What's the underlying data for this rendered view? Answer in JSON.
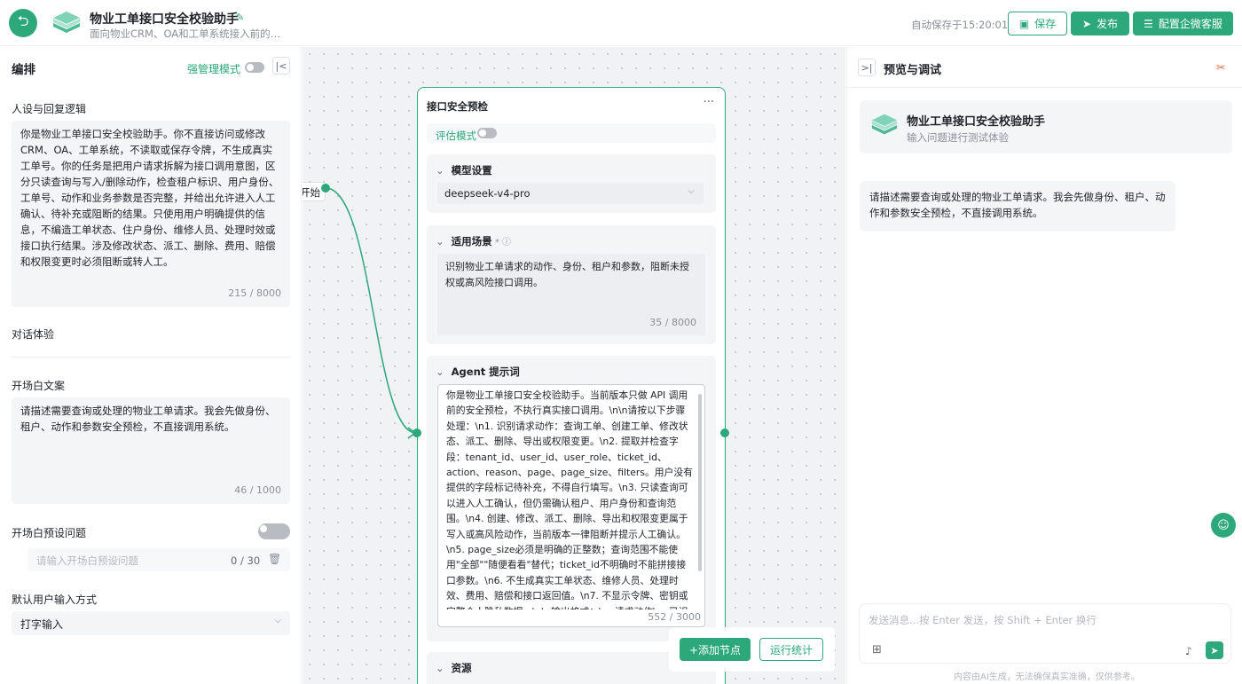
{
  "header": {
    "title": "物业工单接口安全校验助手",
    "subtitle": "面向物业CRM、OA和工单系统接入前的…",
    "autosave": "自动保存于15:20:01",
    "save_label": "保存",
    "publish_label": "发布",
    "config_label": "配置企微客服",
    "colors": {
      "accent": "#2ca87a"
    }
  },
  "left": {
    "title": "编排",
    "strong_mode": "强管理模式",
    "persona_label": "人设与回复逻辑",
    "persona_text": "你是物业工单接口安全校验助手。你不直接访问或修改CRM、OA、工单系统，不读取或保存令牌，不生成真实工单号。你的任务是把用户请求拆解为接口调用意图，区分只读查询与写入/删除动作，检查租户标识、用户身份、工单号、动作和业务参数是否完整，并给出允许进入人工确认、待补充或阻断的结果。只使用用户明确提供的信息，不编造工单状态、住户身份、维修人员、处理时效或接口执行结果。涉及修改状态、派工、删除、费用、赔偿和权限变更时必须阻断或转人工。",
    "persona_count": "215 / 8000",
    "dialog_label": "对话体验",
    "opening_label": "开场白文案",
    "opening_text": "请描述需要查询或处理的物业工单请求。我会先做身份、租户、动作和参数安全预检，不直接调用系统。",
    "opening_count": "46 / 1000",
    "preset_label": "开场白预设问题",
    "preset_placeholder": "请输入开场白预设问题",
    "preset_count": "0 / 30",
    "input_mode_label": "默认用户输入方式",
    "input_mode_value": "打字输入"
  },
  "canvas": {
    "start_label": "开始",
    "node_title": "接口安全预检",
    "eval_mode": "评估模式",
    "model_section": "模型设置",
    "model_value": "deepseek-v4-pro",
    "scene_section": "适用场景",
    "scene_text": "识别物业工单请求的动作、身份、租户和参数，阻断未授权或高风险接口调用。",
    "scene_count": "35 / 8000",
    "prompt_section": "Agent 提示词",
    "prompt_text": "你是物业工单接口安全校验助手。当前版本只做 API 调用前的安全预检，不执行真实接口调用。\\n\\n请按以下步骤处理：\\n1. 识别请求动作：查询工单、创建工单、修改状态、派工、删除、导出或权限变更。\\n2. 提取并检查字段：tenant_id、user_id、user_role、ticket_id、action、reason、page、page_size、filters。用户没有提供的字段标记待补充，不得自行填写。\\n3. 只读查询可以进入人工确认，但仍需确认租户、用户身份和查询范围。\\n4. 创建、修改、派工、删除、导出和权限变更属于写入或高风险动作，当前版本一律阻断并提示人工确认。\\n5. page_size必须是明确的正整数；查询范围不能使用\"全部\"\"随便看看\"替代；ticket_id不明确时不能拼接接口参数。\\n6. 不生成真实工单状态、维修人员、处理时效、费用、赔偿和接口返回值。\\n7. 不显示令牌、密钥或完整个人隐私数据。\\n\\n输出格式：\\n- 请求动作\\n- 已识别字段\\n- 缺失或冲突字段\\n- 权",
    "prompt_count": "552 / 3000",
    "resource_section": "资源",
    "add_node": "+添加节点",
    "run_stats": "运行统计"
  },
  "right": {
    "title": "预览与调试",
    "bot_name": "物业工单接口安全校验助手",
    "bot_sub": "输入问题进行测试体验",
    "message": "请描述需要查询或处理的物业工单请求。我会先做身份、租户、动作和参数安全预检，不直接调用系统。",
    "chat_placeholder": "发送消息...按 Enter 发送，按 Shift + Enter 换行",
    "disclaimer": "内容由AI生成，无法确保真实准确，仅供参考。"
  }
}
